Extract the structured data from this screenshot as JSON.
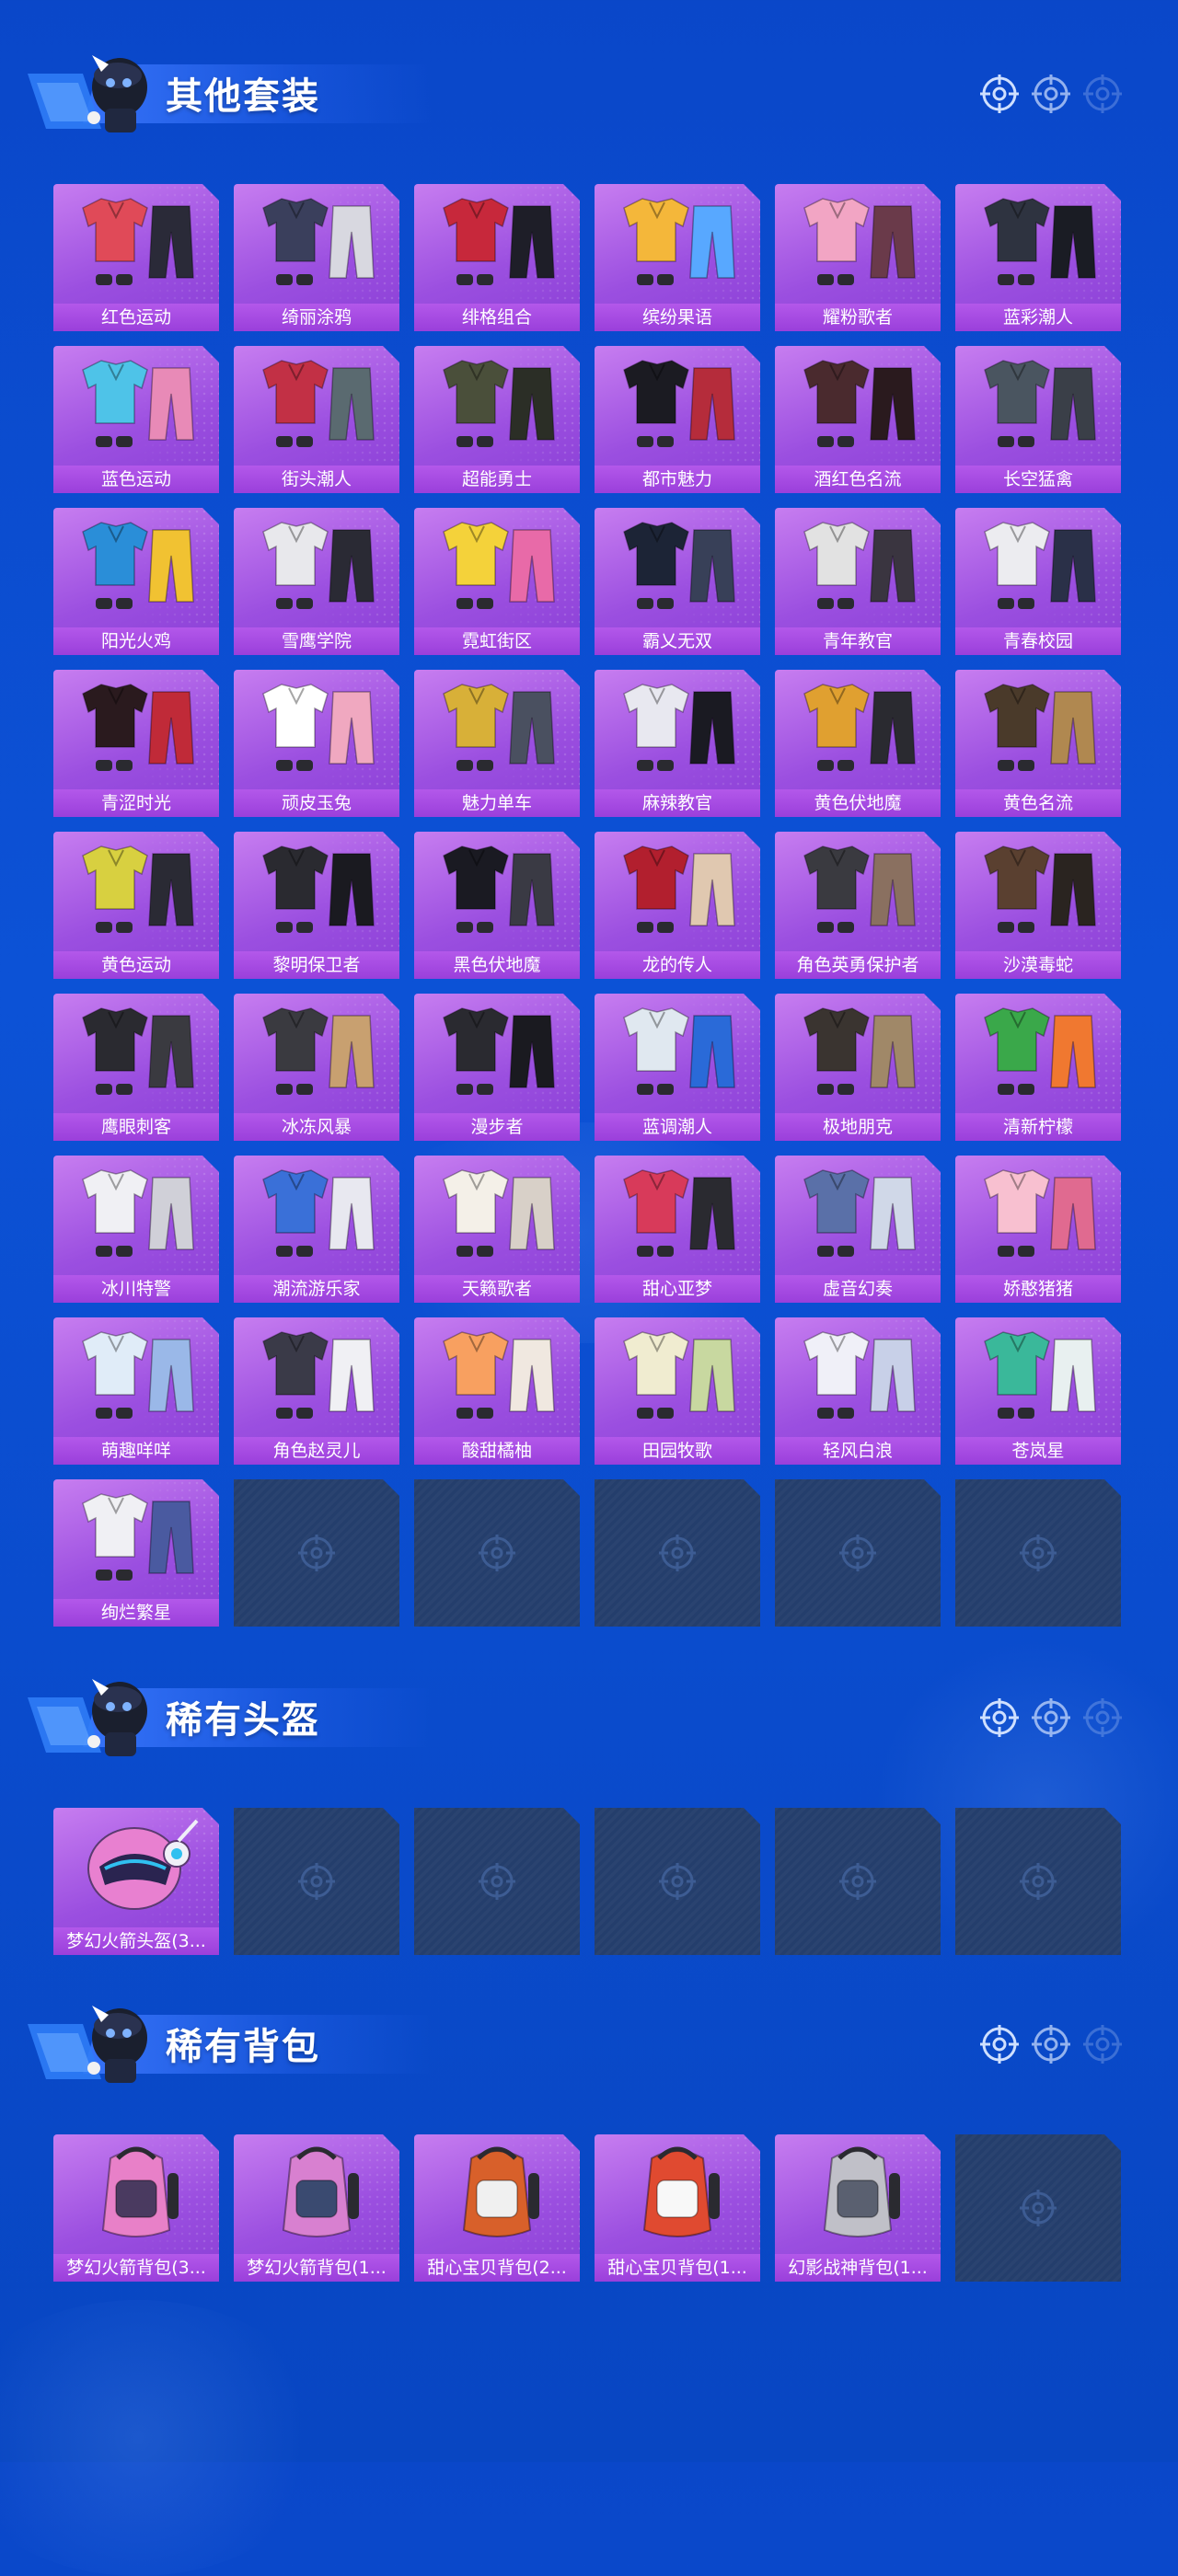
{
  "colors": {
    "background": "#0c52d6",
    "card": "#9b4fe0",
    "empty_slot": "#243e6c",
    "text": "#ffffff"
  },
  "sections": [
    {
      "title": "其他套装",
      "items": [
        "红色运动",
        "绮丽涂鸦",
        "绯格组合",
        "缤纷果语",
        "耀粉歌者",
        "蓝彩潮人",
        "蓝色运动",
        "街头潮人",
        "超能勇士",
        "都市魅力",
        "酒红色名流",
        "长空猛禽",
        "阳光火鸡",
        "雪鹰学院",
        "霓虹街区",
        "霸乂无双",
        "青年教官",
        "青春校园",
        "青涩时光",
        "顽皮玉兔",
        "魅力单车",
        "麻辣教官",
        "黄色伏地魔",
        "黄色名流",
        "黄色运动",
        "黎明保卫者",
        "黑色伏地魔",
        "龙的传人",
        "角色英勇保护者",
        "沙漠毒蛇",
        "鹰眼刺客",
        "冰冻风暴",
        "漫步者",
        "蓝调潮人",
        "极地朋克",
        "清新柠檬",
        "冰川特警",
        "潮流游乐家",
        "天籁歌者",
        "甜心亚梦",
        "虚音幻奏",
        "娇憨猪猪",
        "萌趣咩咩",
        "角色赵灵儿",
        "酸甜橘柚",
        "田园牧歌",
        "轻风白浪",
        "苍岚星",
        "绚烂繁星"
      ],
      "empty_slots": 5
    },
    {
      "title": "稀有头盔",
      "items": [
        "梦幻火箭头盔(3..."
      ],
      "empty_slots": 5
    },
    {
      "title": "稀有背包",
      "items": [
        "梦幻火箭背包(3...",
        "梦幻火箭背包(1...",
        "甜心宝贝背包(2...",
        "甜心宝贝背包(1...",
        "幻影战神背包(1..."
      ],
      "empty_slots": 1
    }
  ]
}
